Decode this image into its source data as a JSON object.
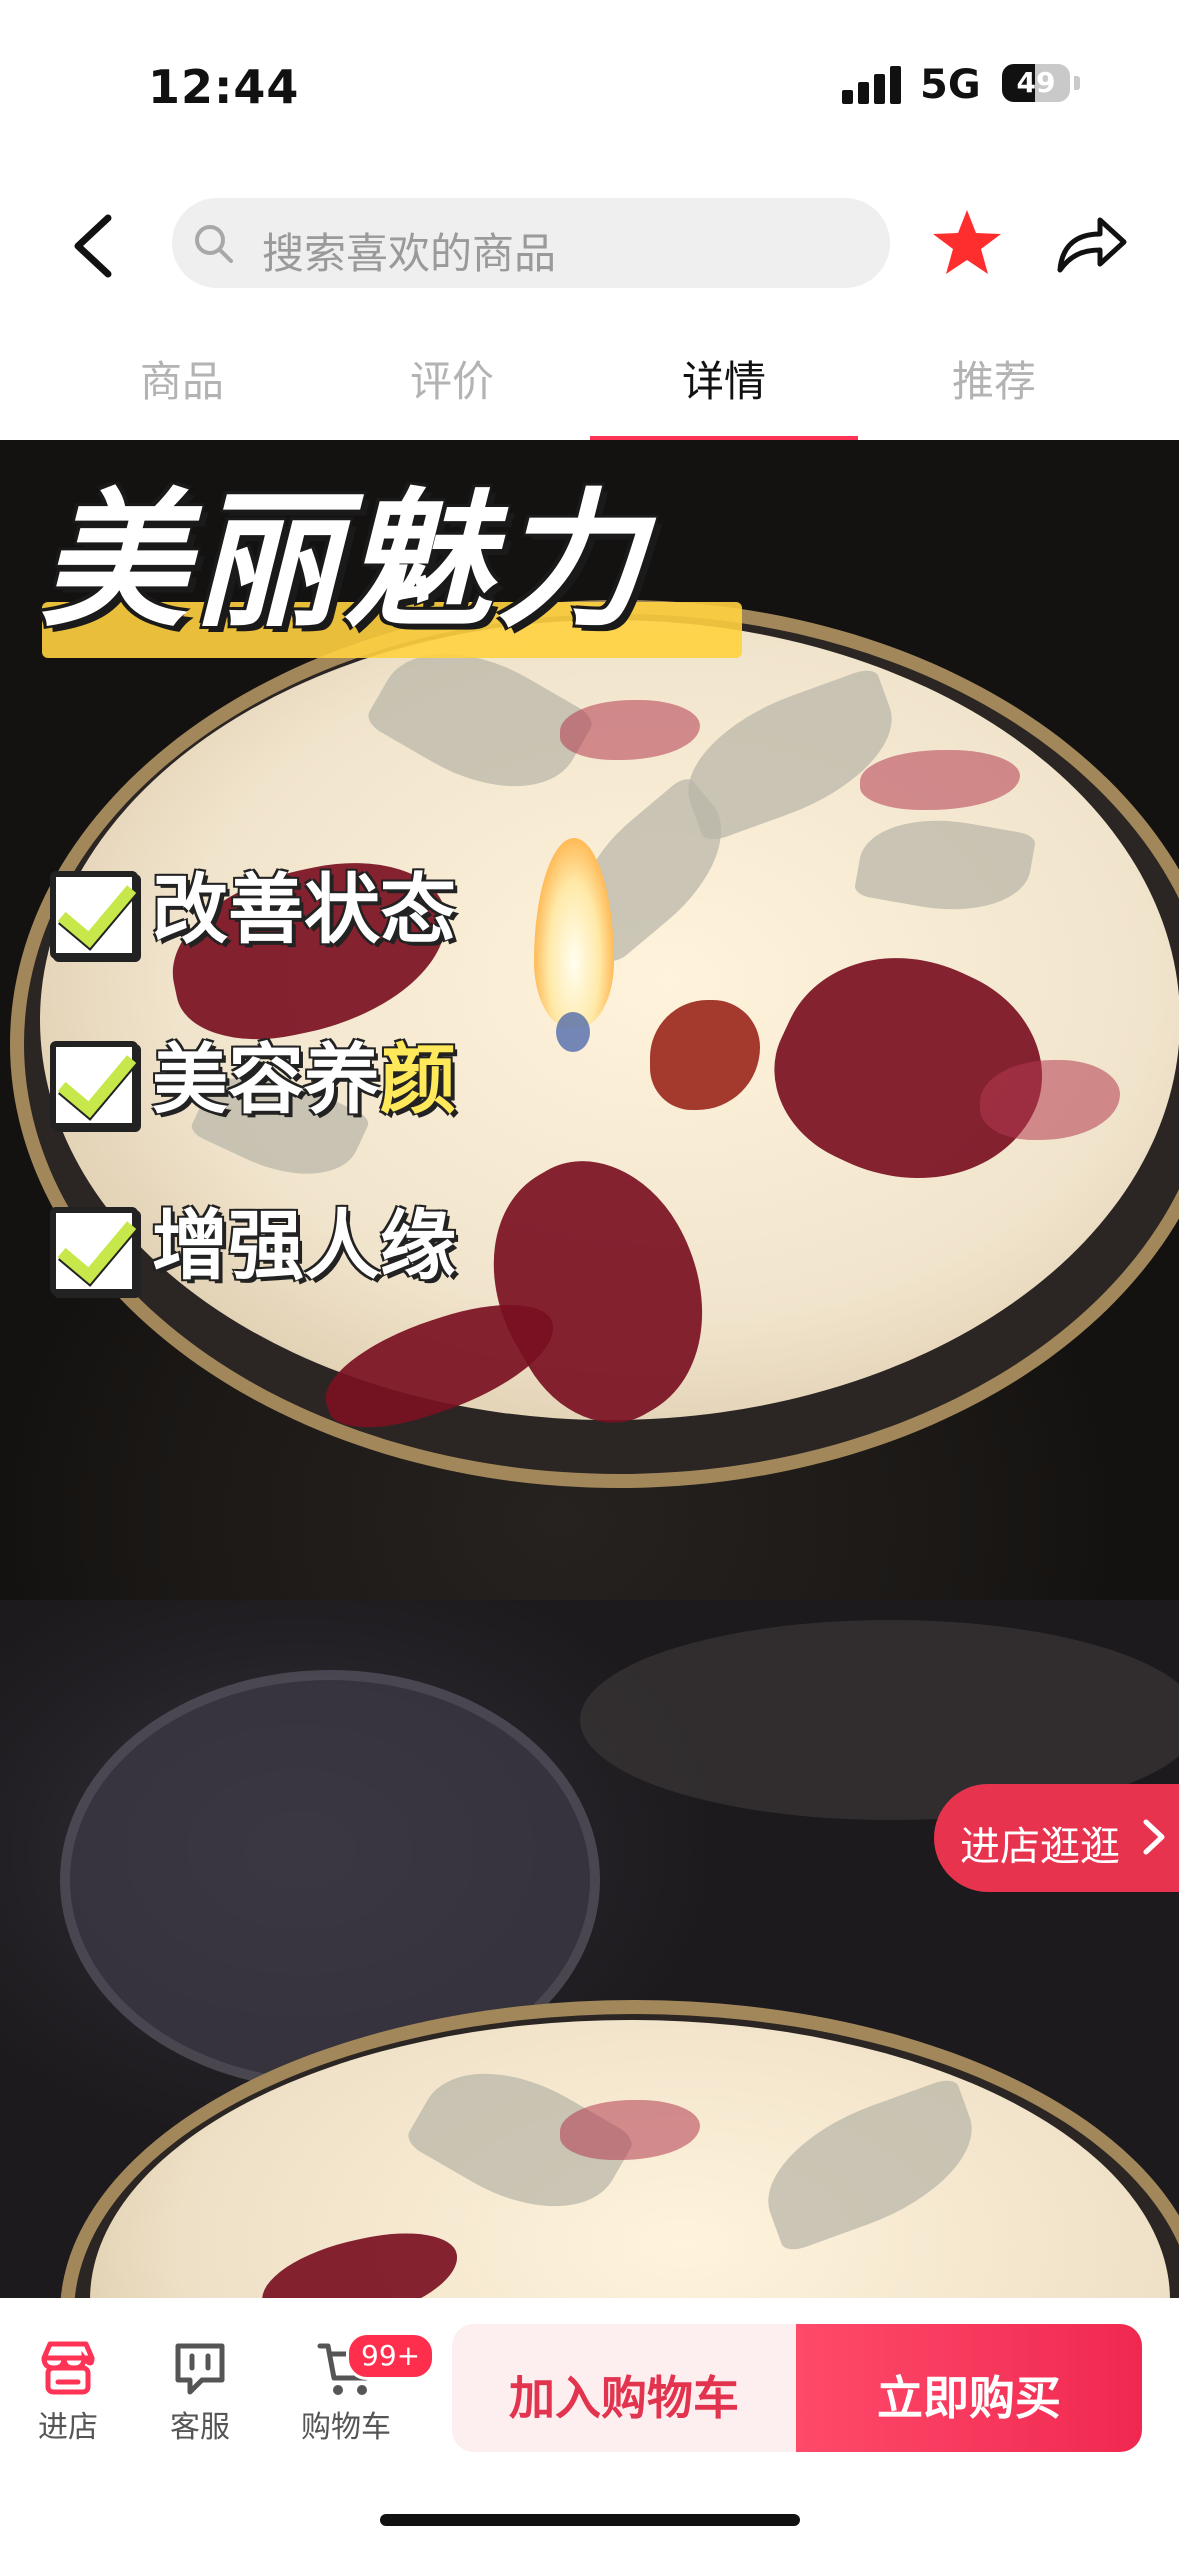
{
  "status_bar": {
    "time": "12:44",
    "network": "5G",
    "battery": "49",
    "battery_level": 0.49
  },
  "nav": {
    "search_placeholder": "搜索喜欢的商品",
    "icons": [
      "back-icon",
      "search-icon",
      "star-icon",
      "share-icon"
    ],
    "favorite_color": "#ff2e2e"
  },
  "tabs": [
    {
      "label": "商品"
    },
    {
      "label": "评价"
    },
    {
      "label": "详情"
    },
    {
      "label": "推荐"
    }
  ],
  "active_tab": "详情",
  "hero": {
    "headline": "美丽魅力",
    "benefits": [
      {
        "plain": "改善状态",
        "highlight": ""
      },
      {
        "plain": "美容养",
        "highlight": "颜"
      },
      {
        "plain": "增强人缘",
        "highlight": ""
      }
    ]
  },
  "shop_float": {
    "label": "进店逛逛"
  },
  "bottom_bar": {
    "items": [
      {
        "label": "进店",
        "icon": "store-icon"
      },
      {
        "label": "客服",
        "icon": "customer-service-icon"
      },
      {
        "label": "购物车",
        "icon": "cart-icon"
      }
    ],
    "cart_badge": "99+",
    "add_to_cart": "加入购物车",
    "buy_now": "立即购买",
    "accent_color": "#f02850"
  }
}
